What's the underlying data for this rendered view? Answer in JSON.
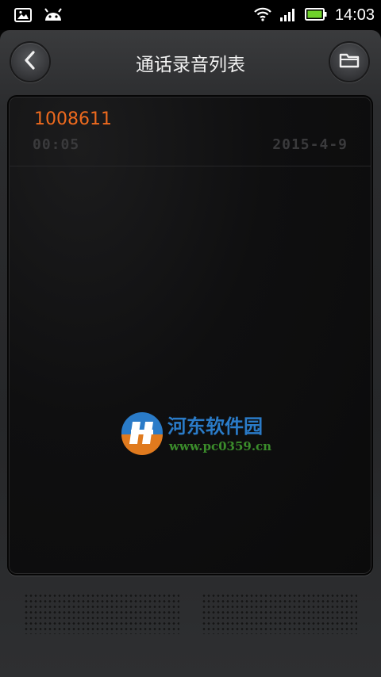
{
  "status_bar": {
    "time": "14:03",
    "icons": [
      "image-icon",
      "android-icon",
      "wifi-icon",
      "signal-icon",
      "battery-icon"
    ]
  },
  "header": {
    "title": "通话录音列表",
    "back_icon": "back-chevron-icon",
    "folder_icon": "folder-icon"
  },
  "recordings": [
    {
      "number": "1008611",
      "duration": "00:05",
      "date": "2015-4-9"
    }
  ],
  "watermark": {
    "name": "河东软件园",
    "url": "www.pc0359.cn"
  },
  "colors": {
    "accent": "#ee6a1e",
    "lcd_text": "#3a3a3c",
    "watermark_blue": "#2a7bc8",
    "watermark_green": "#3b8d2b"
  }
}
